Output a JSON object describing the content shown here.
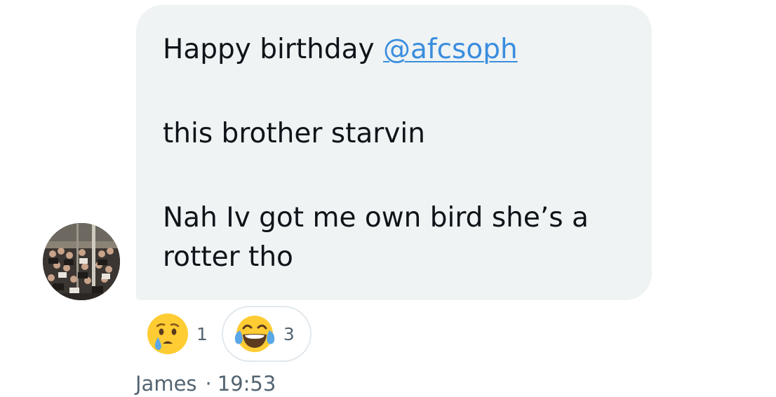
{
  "message": {
    "line1_prefix": "Happy birthday ",
    "mention": "@afcsoph",
    "line2": "this brother starvin",
    "line3": "Nah Iv got me own bird she’s a",
    "line4": "rotter tho"
  },
  "reactions": [
    {
      "icon": "crying-face-icon",
      "count": "1",
      "selected": false
    },
    {
      "icon": "tears-of-joy-face-icon",
      "count": "3",
      "selected": true
    }
  ],
  "meta": {
    "sender": "James",
    "separator": "·",
    "time": "19:53"
  },
  "colors": {
    "bubble": "#eff3f4",
    "text": "#0f1419",
    "mention": "#3a8dde",
    "secondary_text": "#536471",
    "reaction_border": "#e1e8ed"
  }
}
